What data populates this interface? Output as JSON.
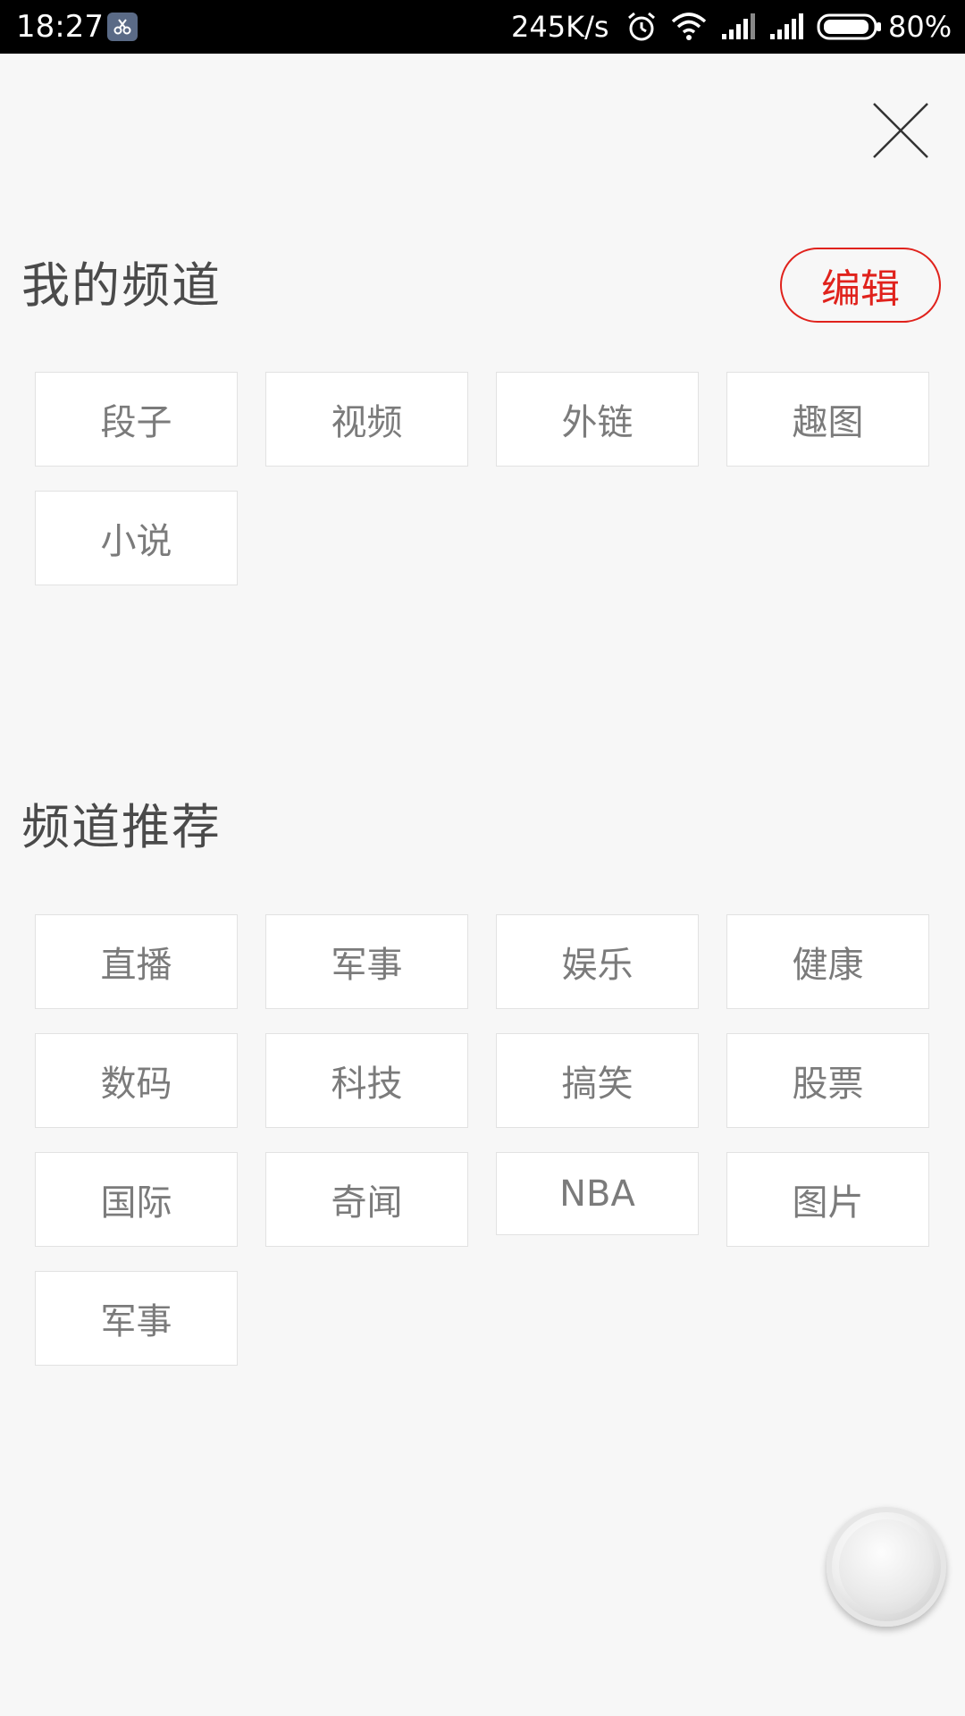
{
  "status_bar": {
    "time": "18:27",
    "speed": "245K/s",
    "battery_percent": "80%",
    "icons": [
      "scissors-app-icon",
      "alarm-icon",
      "wifi-icon",
      "signal-icon",
      "signal-icon",
      "battery-icon"
    ],
    "battery_level": 0.8
  },
  "my_channels": {
    "title": "我的频道",
    "edit_label": "编辑",
    "items": [
      "段子",
      "视频",
      "外链",
      "趣图",
      "小说"
    ]
  },
  "recommended": {
    "title": "频道推荐",
    "items": [
      "直播",
      "军事",
      "娱乐",
      "健康",
      "数码",
      "科技",
      "搞笑",
      "股票",
      "国际",
      "奇闻",
      "NBA",
      "图片",
      "军事"
    ]
  },
  "colors": {
    "accent": "#e0221c",
    "background": "#f7f7f7",
    "tile_text": "#7b7b7b",
    "heading": "#4a4a4a"
  }
}
